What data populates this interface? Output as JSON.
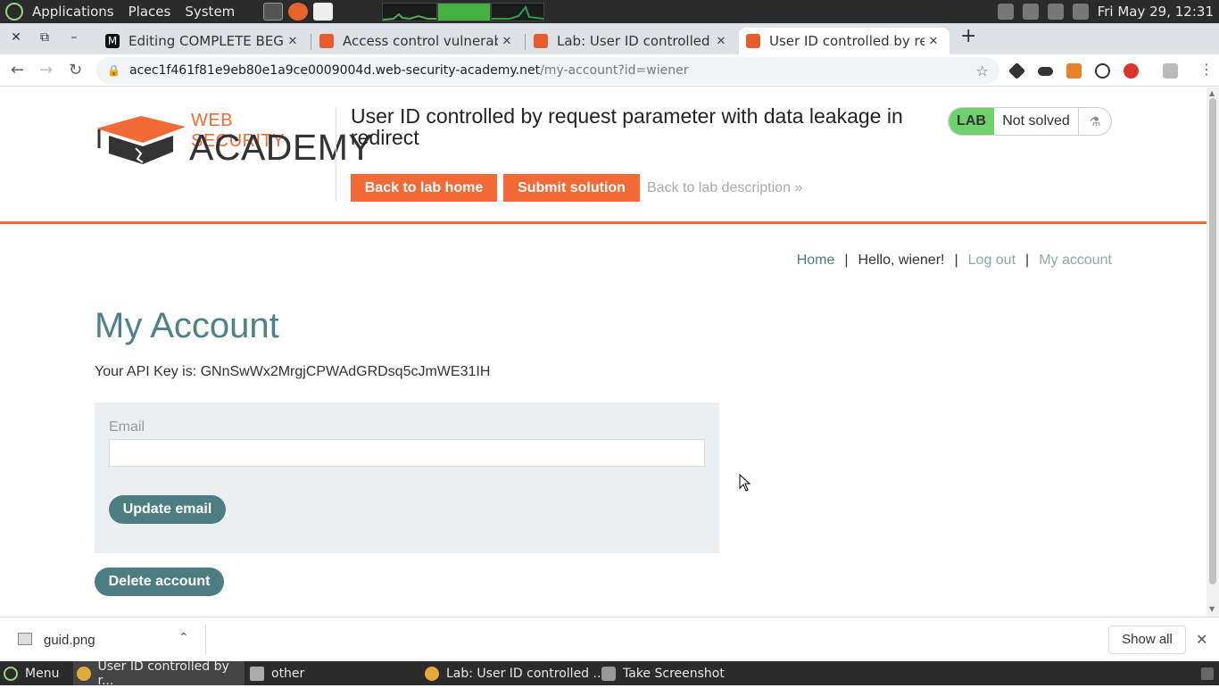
{
  "system_panel": {
    "menus": [
      "Applications",
      "Places",
      "System"
    ],
    "clock": "Fri May 29, 12:31"
  },
  "tabs": [
    {
      "title": "Editing COMPLETE BEGIN",
      "favicon_color": "#111111"
    },
    {
      "title": "Access control vulnerabilit",
      "favicon_color": "#e65c2b"
    },
    {
      "title": "Lab: User ID controlled by",
      "favicon_color": "#e65c2b"
    },
    {
      "title": "User ID controlled by requ",
      "favicon_color": "#e65c2b",
      "active": true
    }
  ],
  "address_bar": {
    "host": "acec1f461f81e9eb80e1a9ce0009004d.web-security-academy.net",
    "path": "/my-account?id=wiener"
  },
  "header": {
    "logo_line1": "WEB SECURITY",
    "logo_line2": "ACADEMY",
    "lab_title": "User ID controlled by request parameter with data leakage in redirect",
    "back_to_lab_home": "Back to lab home",
    "submit_solution": "Submit solution",
    "back_to_description": "Back to lab description",
    "lab_label": "LAB",
    "lab_status": "Not solved"
  },
  "nav": {
    "home": "Home",
    "greeting": "Hello, wiener!",
    "logout": "Log out",
    "my_account": "My account",
    "separator": "|"
  },
  "main": {
    "heading": "My Account",
    "api_key_text": "Your API Key is: GNnSwWx2MrgjCPWAdGRDsq5cJmWE31IH",
    "email_label": "Email",
    "email_value": "",
    "update_email": "Update email",
    "delete_account": "Delete account"
  },
  "download_bar": {
    "file": "guid.png",
    "show_all": "Show all"
  },
  "taskbar": {
    "menu": "Menu",
    "items": [
      {
        "label": "User ID controlled by r..."
      },
      {
        "label": "other"
      },
      {
        "label": "Lab: User ID controlled ..."
      },
      {
        "label": "Take Screenshot"
      }
    ]
  },
  "colors": {
    "accent_orange": "#f26a35",
    "teal": "#4c7e81",
    "lab_green": "#70d16d"
  }
}
